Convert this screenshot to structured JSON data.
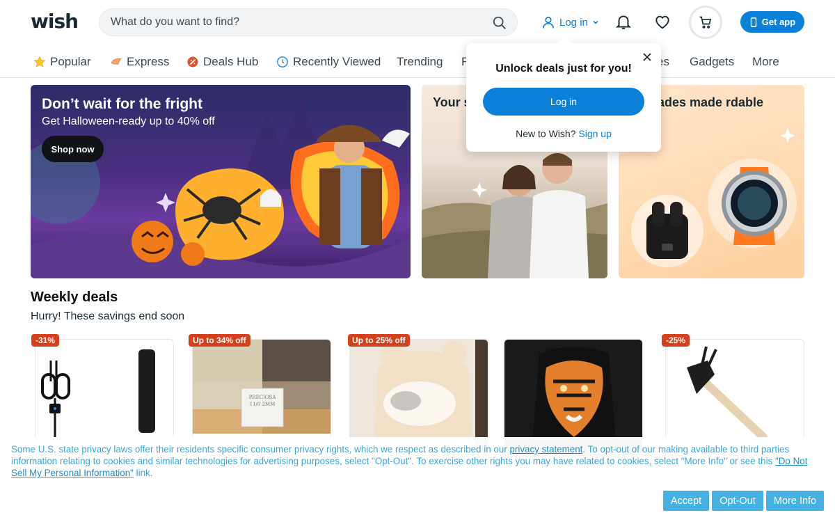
{
  "header": {
    "logo": "wish",
    "search_placeholder": "What do you want to find?",
    "login_label": "Log in",
    "get_app_label": "Get app"
  },
  "categories": [
    {
      "label": "Popular",
      "icon": "star-icon"
    },
    {
      "label": "Express",
      "icon": "express-icon"
    },
    {
      "label": "Deals Hub",
      "icon": "deals-tag-icon"
    },
    {
      "label": "Recently Viewed",
      "icon": "clock-icon"
    },
    {
      "label": "Trending",
      "icon": ""
    },
    {
      "label": "F",
      "icon": ""
    },
    {
      "label": "es",
      "icon": ""
    },
    {
      "label": "Gadgets",
      "icon": ""
    },
    {
      "label": "More",
      "icon": ""
    }
  ],
  "banners": [
    {
      "title": "Don’t wait for the fright",
      "subtitle": "Get Halloween-ready up to 40% off",
      "cta": "Shop now"
    },
    {
      "title": "Your starts"
    },
    {
      "title": "upgrades made rdable"
    }
  ],
  "weekly_deals": {
    "title": "Weekly deals",
    "subtitle": "Hurry! These savings end soon",
    "badges": [
      "-31%",
      "Up to 34% off",
      "Up to 25% off",
      "-25%"
    ],
    "product_label": "PRECIOSA 11/0 2MM"
  },
  "popup": {
    "title": "Unlock deals just for you!",
    "login_label": "Log in",
    "new_text": "New to Wish?",
    "signup_label": "Sign up"
  },
  "cookie": {
    "text_1": "Some U.S. state privacy laws offer their residents specific consumer privacy rights, which we respect as described in our ",
    "link_1": "privacy statement",
    "text_2": ". To opt-out of our making available to third parties information relating to cookies and similar technologies for advertising purposes, select \"Opt-Out\". To exercise other rights you may have related to cookies, select \"More Info\" or see this ",
    "link_2": "\"Do Not Sell My Personal Information\"",
    "text_3": " link.",
    "accept_label": "Accept",
    "optout_label": "Opt-Out",
    "moreinfo_label": "More Info"
  },
  "colors": {
    "brand_blue": "#0a80d8",
    "badge_red": "#d43f1c",
    "cookie_blue": "#45b0e2"
  }
}
